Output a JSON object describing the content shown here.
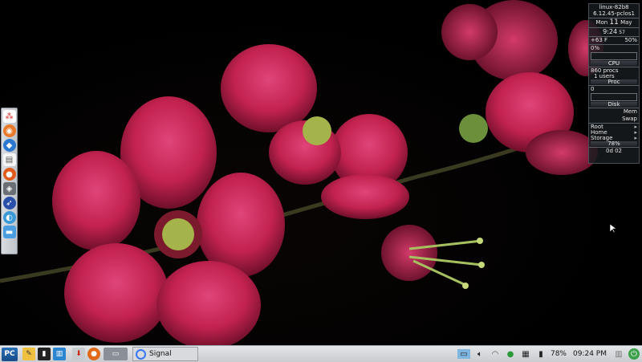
{
  "conky": {
    "hostname": "linux-82b8",
    "kernel": "6.12.45-pclos1",
    "day": "Mon",
    "date": "11",
    "month": "May",
    "time": "9:24",
    "seconds": "57",
    "temp": "+63 F",
    "battery_percent": "50%",
    "cpu_percent": "0%",
    "cpu_label": "CPU",
    "procs": "860 procs",
    "users": "1 users",
    "proc_label": "Proc",
    "proc_value": "0",
    "disk_label": "Disk",
    "mem_label": "Mem",
    "swap_label": "Swap",
    "root_label": "Root",
    "home_label": "Home",
    "storage_label": "Storage",
    "storage_percent": "78%",
    "uptime": "0d  02"
  },
  "dock": {
    "icons": [
      "grid-apps-icon",
      "synaptic-icon",
      "blue-app-icon",
      "document-icon",
      "firefox-icon",
      "network-icon",
      "rocket-icon",
      "globe-icon",
      "folder-icon"
    ]
  },
  "taskbar": {
    "start_label": "PC",
    "task_label": "Signal",
    "battery": "78%",
    "clock": "09:24 PM"
  },
  "colors": {
    "taskbar_bg": "#d4d6d9",
    "conky_bg": "#1c2024",
    "flower": "#c2224e"
  }
}
